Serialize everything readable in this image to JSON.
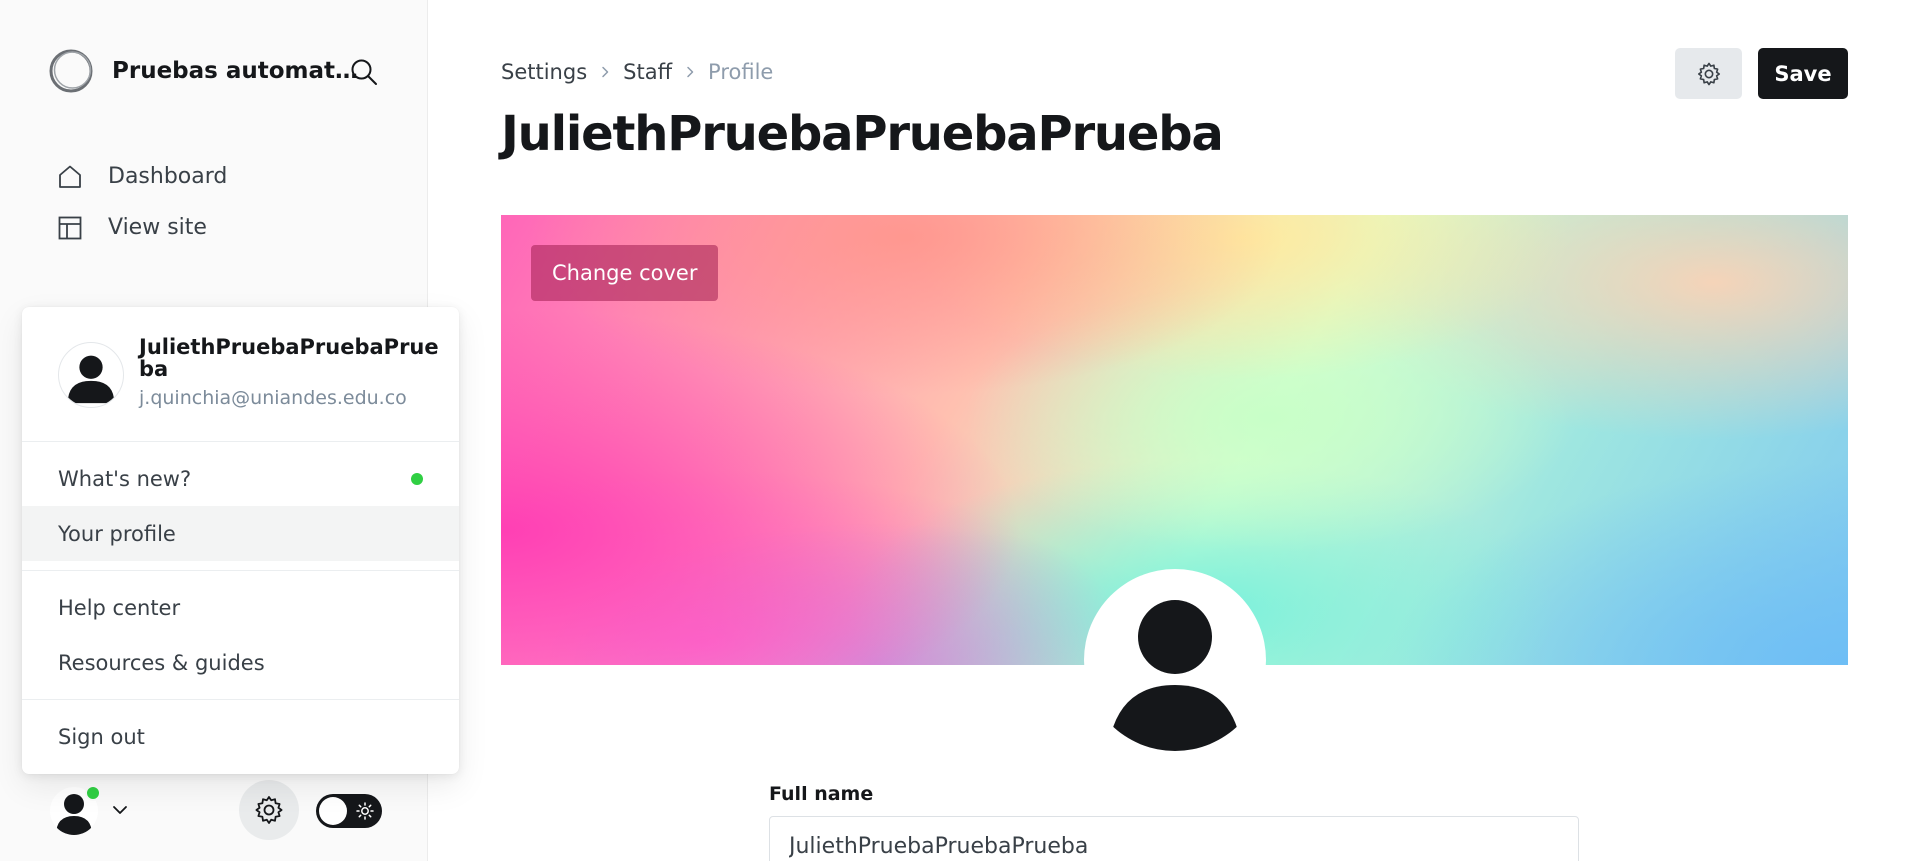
{
  "sidebar": {
    "brand_title": "Pruebas automat…",
    "nav": [
      {
        "label": "Dashboard",
        "icon": "home-icon"
      },
      {
        "label": "View site",
        "icon": "layout-icon"
      }
    ]
  },
  "user_menu": {
    "name": "JuliethPruebaPruebaPrueba",
    "email": "j.quinchia@uniandes.edu.co",
    "sections": [
      [
        {
          "label": "What's new?",
          "dot": true
        },
        {
          "label": "Your profile",
          "active": true
        }
      ],
      [
        {
          "label": "Help center"
        },
        {
          "label": "Resources & guides"
        }
      ],
      [
        {
          "label": "Sign out"
        }
      ]
    ]
  },
  "breadcrumb": {
    "settings": "Settings",
    "staff": "Staff",
    "current": "Profile"
  },
  "page": {
    "title": "JuliethPruebaPruebaPrueba",
    "save_label": "Save",
    "change_cover_label": "Change cover"
  },
  "form": {
    "full_name_label": "Full name",
    "full_name_value": "JuliethPruebaPruebaPrueba"
  },
  "colors": {
    "accent_dark": "#15171a",
    "online_green": "#30cf43",
    "muted_text": "#7c8b9a"
  }
}
